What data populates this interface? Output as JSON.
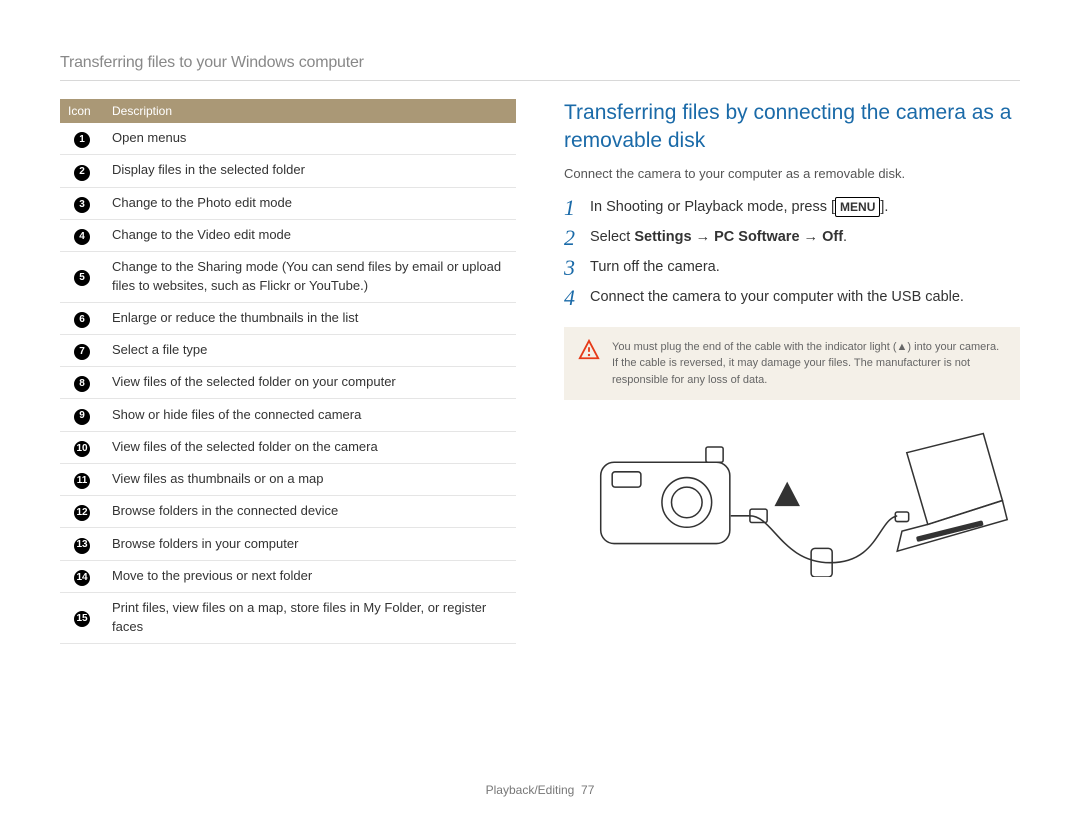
{
  "section_title": "Transferring files to your Windows computer",
  "table": {
    "headers": {
      "icon": "Icon",
      "desc": "Description"
    },
    "rows": [
      "Open menus",
      "Display files in the selected folder",
      "Change to the Photo edit mode",
      "Change to the Video edit mode",
      "Change to the Sharing mode (You can send files by email or upload files to websites, such as Flickr or YouTube.)",
      "Enlarge or reduce the thumbnails in the list",
      "Select a file type",
      "View files of the selected folder on your computer",
      "Show or hide files of the connected camera",
      "View files of the selected folder on the camera",
      "View files as thumbnails or on a map",
      "Browse folders in the connected device",
      "Browse folders in your computer",
      "Move to the previous or next folder",
      "Print files, view files on a map, store files in My Folder, or register faces"
    ]
  },
  "right": {
    "heading": "Transferring files by connecting the camera as a removable disk",
    "intro": "Connect the camera to your computer as a removable disk.",
    "steps": {
      "1_a": "In Shooting or Playback mode, press [",
      "1_menu": "MENU",
      "1_b": "].",
      "2_a": "Select ",
      "2_b": "Settings",
      "2_c": " → ",
      "2_d": "PC Software",
      "2_e": " → ",
      "2_f": "Off",
      "2_g": ".",
      "3": "Turn off the camera.",
      "4": "Connect the camera to your computer with the USB cable."
    },
    "note": "You must plug the end of the cable with the indicator light (▲) into your camera. If the cable is reversed, it may damage your files. The manufacturer is not responsible for any loss of data.",
    "step_labels": {
      "1": "1",
      "2": "2",
      "3": "3",
      "4": "4"
    },
    "icon_labels": [
      "1",
      "2",
      "3",
      "4",
      "5",
      "6",
      "7",
      "8",
      "9",
      "10",
      "11",
      "12",
      "13",
      "14",
      "15"
    ]
  },
  "footer": {
    "section": "Playback/Editing",
    "page": "77"
  }
}
